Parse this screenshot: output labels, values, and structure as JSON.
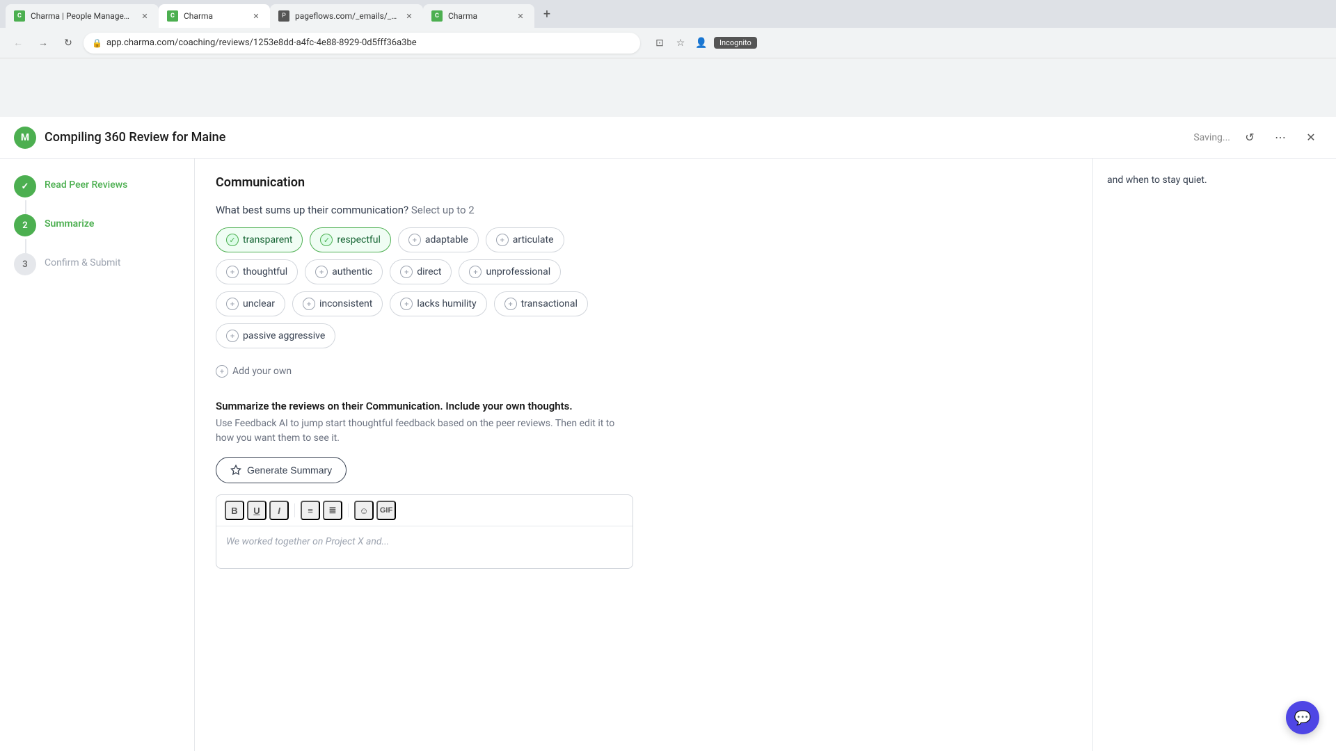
{
  "browser": {
    "tabs": [
      {
        "id": "tab1",
        "favicon_type": "charma",
        "favicon_text": "C",
        "title": "Charma | People Management S...",
        "active": false
      },
      {
        "id": "tab2",
        "favicon_type": "charma",
        "favicon_text": "C",
        "title": "Charma",
        "active": true
      },
      {
        "id": "tab3",
        "favicon_type": "pageflows",
        "favicon_text": "P",
        "title": "pageflows.com/_emails/_j7fb5...",
        "active": false
      },
      {
        "id": "tab4",
        "favicon_type": "charma",
        "favicon_text": "C",
        "title": "Charma",
        "active": false
      }
    ],
    "url": "app.charma.com/coaching/reviews/1253e8dd-a4fc-4e88-8929-0d5fff36a3be",
    "incognito_label": "Incognito"
  },
  "header": {
    "logo_text": "M",
    "title": "Compiling 360 Review for Maine",
    "saving_text": "Saving...",
    "history_icon": "↺",
    "more_icon": "⋯",
    "close_icon": "✕"
  },
  "sidebar": {
    "steps": [
      {
        "number": "✓",
        "label": "Read Peer Reviews",
        "state": "completed"
      },
      {
        "number": "2",
        "label": "Summarize",
        "state": "active"
      },
      {
        "number": "3",
        "label": "Confirm & Submit",
        "state": "inactive"
      }
    ]
  },
  "main": {
    "section_title": "Communication",
    "question": "What best sums up their communication?",
    "select_hint": "Select up to 2",
    "tags": [
      {
        "id": "transparent",
        "label": "transparent",
        "selected": true
      },
      {
        "id": "respectful",
        "label": "respectful",
        "selected": true
      },
      {
        "id": "adaptable",
        "label": "adaptable",
        "selected": false
      },
      {
        "id": "articulate",
        "label": "articulate",
        "selected": false
      },
      {
        "id": "thoughtful",
        "label": "thoughtful",
        "selected": false
      },
      {
        "id": "authentic",
        "label": "authentic",
        "selected": false
      },
      {
        "id": "direct",
        "label": "direct",
        "selected": false
      },
      {
        "id": "unprofessional",
        "label": "unprofessional",
        "selected": false
      },
      {
        "id": "unclear",
        "label": "unclear",
        "selected": false
      },
      {
        "id": "inconsistent",
        "label": "inconsistent",
        "selected": false
      },
      {
        "id": "lacks_humility",
        "label": "lacks humility",
        "selected": false
      },
      {
        "id": "transactional",
        "label": "transactional",
        "selected": false
      },
      {
        "id": "passive_aggressive",
        "label": "passive aggressive",
        "selected": false
      }
    ],
    "add_your_own_label": "Add your own",
    "summarize_label": "Summarize the reviews on their Communication. Include your own thoughts.",
    "summarize_sublabel": "Use Feedback AI to jump start thoughtful feedback based on the peer reviews. Then edit it to how you want them to see it.",
    "generate_btn_label": "Generate Summary",
    "editor_placeholder": "We worked together on Project X and...",
    "toolbar_buttons": [
      "B",
      "U",
      "I",
      "|",
      "≡",
      "≣",
      "|",
      "☺",
      "GIF"
    ]
  },
  "right_panel": {
    "text": "and when to stay quiet."
  },
  "chat": {
    "icon": "💬"
  }
}
